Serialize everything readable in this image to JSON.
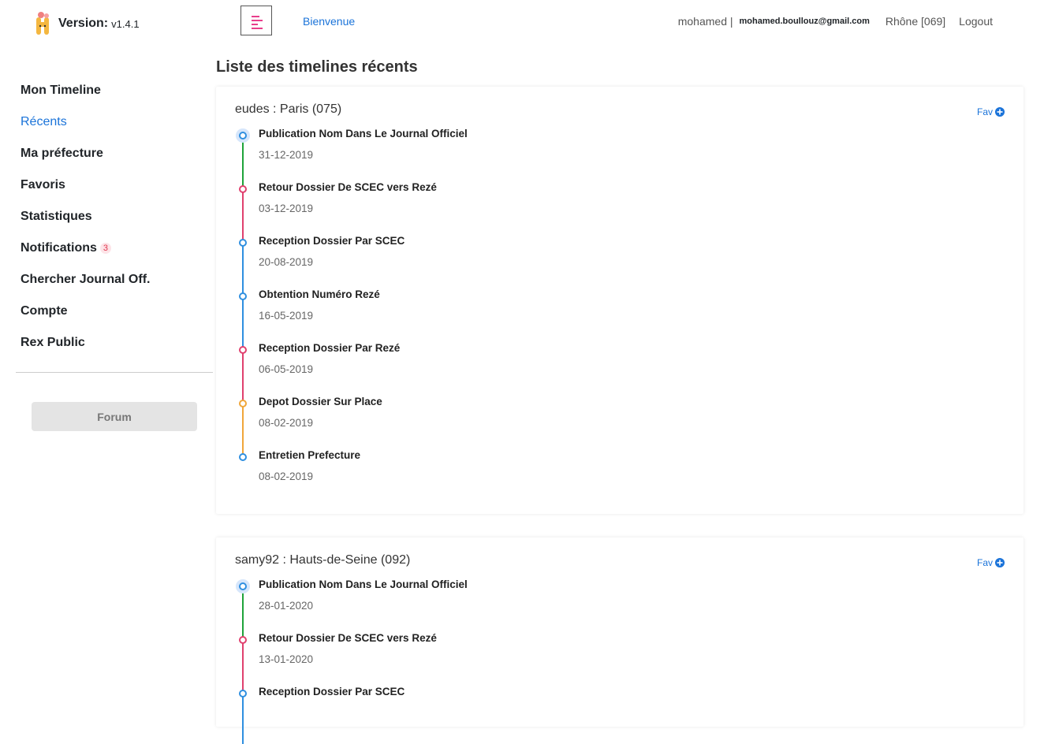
{
  "header": {
    "version_label": "Version:",
    "version_number": "v1.4.1",
    "welcome_link": "Bienvenue",
    "user_name": "mohamed |",
    "user_email": "mohamed.boullouz@gmail.com",
    "prefecture": "Rhône [069]",
    "logout": "Logout",
    "menu_icon": "align-left-icon"
  },
  "sidebar": {
    "items": [
      {
        "label": "Mon Timeline",
        "active": false
      },
      {
        "label": "Récents",
        "active": true
      },
      {
        "label": "Ma préfecture",
        "active": false
      },
      {
        "label": "Favoris",
        "active": false
      },
      {
        "label": "Statistiques",
        "active": false
      },
      {
        "label": "Notifications",
        "active": false,
        "badge": "3"
      },
      {
        "label": "Chercher Journal Off.",
        "active": false
      },
      {
        "label": "Compte",
        "active": false
      },
      {
        "label": "Rex Public",
        "active": false
      }
    ],
    "forum_button": "Forum"
  },
  "main": {
    "title": "Liste des timelines récents",
    "fav_label": "Fav",
    "fav_icon": "plus-circle-icon",
    "timelines": [
      {
        "header": "eudes : Paris (075)",
        "events": [
          {
            "title": "Publication Nom Dans Le Journal Officiel",
            "date": "31-12-2019",
            "color": "#2f8fe0",
            "line_color": "#1fa33a"
          },
          {
            "title": "Retour Dossier De SCEC vers Rezé",
            "date": "03-12-2019",
            "color": "#e0406e",
            "line_color": "#e0406e"
          },
          {
            "title": "Reception Dossier Par SCEC",
            "date": "20-08-2019",
            "color": "#2f8fe0",
            "line_color": "#2f8fe0"
          },
          {
            "title": "Obtention Numéro Rezé",
            "date": "16-05-2019",
            "color": "#2f8fe0",
            "line_color": "#2f8fe0"
          },
          {
            "title": "Reception Dossier Par Rezé",
            "date": "06-05-2019",
            "color": "#e0406e",
            "line_color": "#e0406e"
          },
          {
            "title": "Depot Dossier Sur Place",
            "date": "08-02-2019",
            "color": "#f0a63a",
            "line_color": "#f0a63a"
          },
          {
            "title": "Entretien Prefecture",
            "date": "08-02-2019",
            "color": "#2f8fe0",
            "line_color": null
          }
        ]
      },
      {
        "header": "samy92 : Hauts-de-Seine (092)",
        "events": [
          {
            "title": "Publication Nom Dans Le Journal Officiel",
            "date": "28-01-2020",
            "color": "#2f8fe0",
            "line_color": "#1fa33a"
          },
          {
            "title": "Retour Dossier De SCEC vers Rezé",
            "date": "13-01-2020",
            "color": "#e0406e",
            "line_color": "#e0406e"
          },
          {
            "title": "Reception Dossier Par SCEC",
            "date": "",
            "color": "#2f8fe0",
            "line_color": "#2f8fe0"
          }
        ]
      }
    ]
  }
}
